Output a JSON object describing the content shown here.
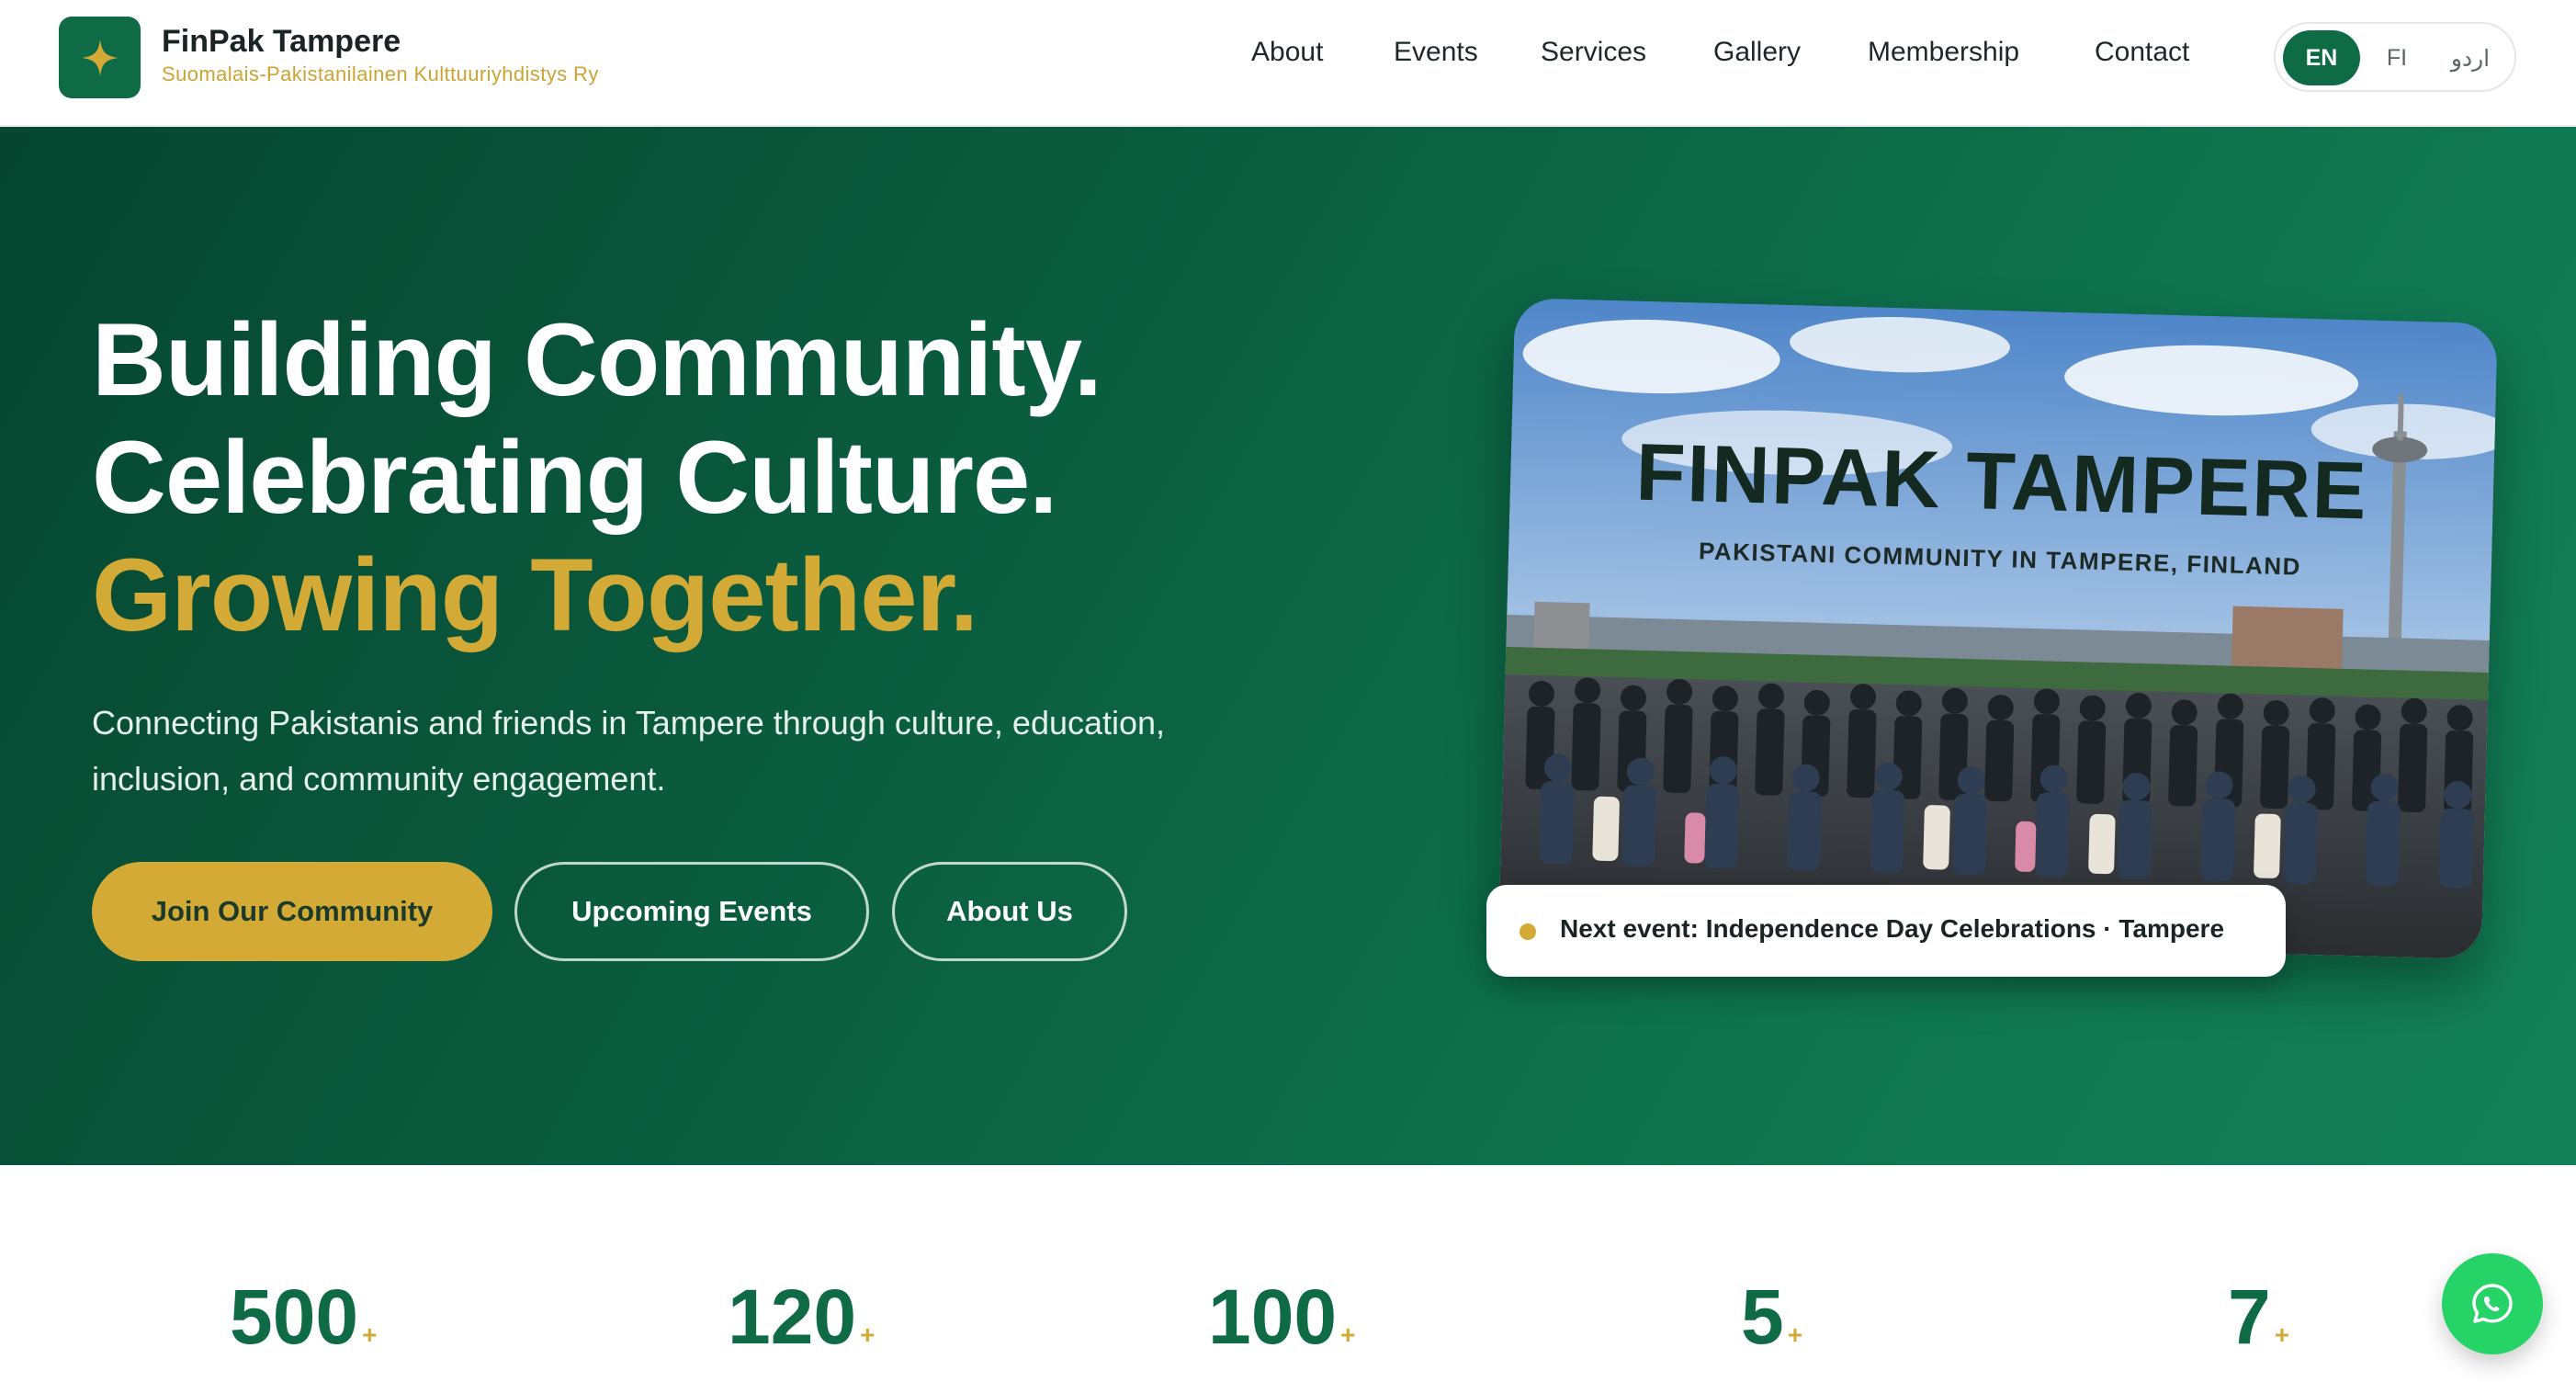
{
  "brand": {
    "name": "FinPak Tampere",
    "subtitle": "Suomalais-Pakistanilainen Kulttuuriyhdistys Ry"
  },
  "nav": {
    "items": [
      "About",
      "Events",
      "Services",
      "Gallery",
      "Membership",
      "Contact"
    ]
  },
  "language": {
    "options": [
      "EN",
      "FI",
      "اردو"
    ],
    "selected": "EN"
  },
  "hero": {
    "title_line1": "Building Community.",
    "title_line2": "Celebrating Culture.",
    "title_line3": "Growing Together.",
    "description": "Connecting Pakistanis and friends in Tampere through culture, education, inclusion, and community engagement.",
    "buttons": {
      "join": "Join Our Community",
      "events": "Upcoming Events",
      "about": "About Us"
    },
    "photo": {
      "title": "FINPAK TAMPERE",
      "subtitle": "PAKISTANI COMMUNITY IN TAMPERE, FINLAND"
    },
    "next_event": "Next event: Independence Day Celebrations · Tampere"
  },
  "stats": [
    {
      "value": "500",
      "suffix": "+"
    },
    {
      "value": "120",
      "suffix": "+"
    },
    {
      "value": "100",
      "suffix": "+"
    },
    {
      "value": "5",
      "suffix": "+"
    },
    {
      "value": "7",
      "suffix": "+"
    }
  ],
  "colors": {
    "primary": "#0e6b45",
    "accent": "#d4aa37",
    "whatsapp": "#25d366"
  },
  "icons": {
    "logo": "sparkle-star-icon",
    "whatsapp": "whatsapp-icon"
  }
}
